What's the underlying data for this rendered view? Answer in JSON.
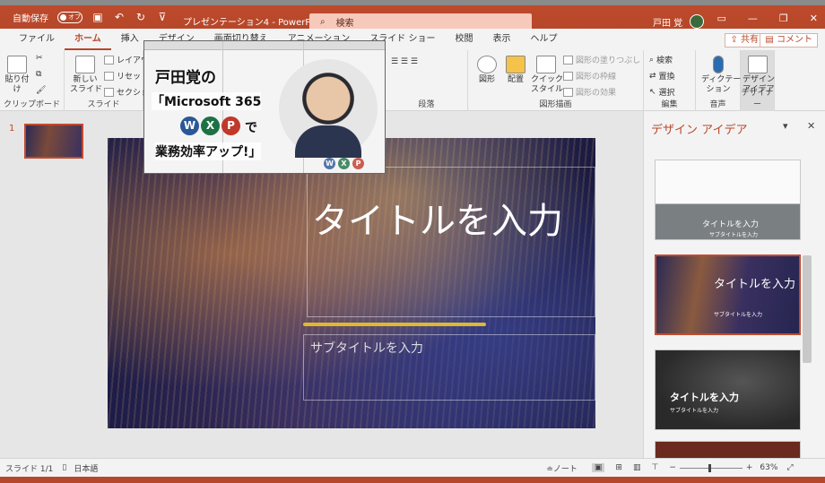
{
  "titlebar": {
    "autosave_label": "自動保存",
    "autosave_state": "オフ",
    "doc_title": "プレゼンテーション4 - PowerPoint",
    "search_placeholder": "検索",
    "user_name": "戸田 覚"
  },
  "tabs": [
    "ファイル",
    "ホーム",
    "挿入",
    "デザイン",
    "画面切り替え",
    "アニメーション",
    "スライド ショー",
    "校閲",
    "表示",
    "ヘルプ"
  ],
  "active_tab": "ホーム",
  "share_label": "共有",
  "comment_label": "コメント",
  "ribbon": {
    "clipboard": {
      "paste": "貼り付け",
      "label": "クリップボード"
    },
    "slides": {
      "new_slide": "新しい\nスライド",
      "layout": "レイアウト",
      "reset": "リセット",
      "section": "セクション",
      "label": "スライド"
    },
    "paragraph": {
      "label": "段落"
    },
    "drawing": {
      "shapes": "図形",
      "arrange": "配置",
      "quick_style": "クイック\nスタイル",
      "fill": "図形の塗りつぶし",
      "outline": "図形の枠線",
      "effect": "図形の効果",
      "label": "図形描画"
    },
    "editing": {
      "find": "検索",
      "replace": "置換",
      "select": "選択",
      "label": "編集"
    },
    "voice": {
      "dictate": "ディクテー\nション",
      "label": "音声"
    },
    "designer": {
      "ideas": "デザイン\nアイデア",
      "label": "デザイナー"
    }
  },
  "thumbnail": {
    "number": "1"
  },
  "slide": {
    "title": "タイトルを入力",
    "subtitle": "サブタイトルを入力"
  },
  "overlay_ad": {
    "line1": "戸田覚の",
    "line2": "「Microsoft 365",
    "line3": "で",
    "line4": "業務効率アップ!」",
    "badges": [
      "W",
      "X",
      "P"
    ],
    "colors": {
      "W": "#2b5797",
      "X": "#1e7145",
      "P": "#c0392b"
    }
  },
  "design_pane": {
    "header": "デザイン アイデア",
    "cards": [
      {
        "title": "タイトルを入力",
        "subtitle": "サブタイトルを入力"
      },
      {
        "title": "タイトルを入力",
        "subtitle": "サブタイトルを入力"
      },
      {
        "title": "タイトルを入力",
        "subtitle": "サブタイトルを入力"
      }
    ]
  },
  "status": {
    "slide_count": "スライド 1/1",
    "language": "日本語",
    "notes": "ノート",
    "zoom": "63%"
  },
  "accent": "#b7472a"
}
